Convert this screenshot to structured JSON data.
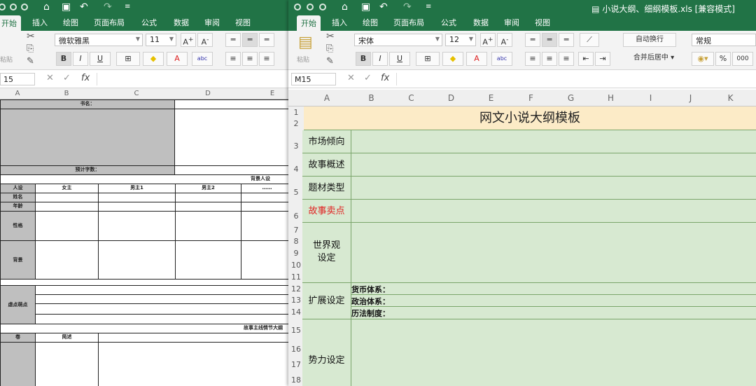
{
  "left_window": {
    "tabs": [
      "开始",
      "插入",
      "绘图",
      "页面布局",
      "公式",
      "数据",
      "审阅",
      "视图"
    ],
    "font_name": "微软雅黑",
    "font_size": "11",
    "paste_label": "粘贴",
    "name_box": "15",
    "fx": "fx",
    "columns": [
      "A",
      "B",
      "C",
      "D",
      "E"
    ],
    "sheet": {
      "book_name": "书名：",
      "word_count": "预计字数：",
      "bg_characters": "背景人设",
      "char_headers": [
        "人设",
        "女主",
        "男主1",
        "男主2",
        "……"
      ],
      "row_name": "姓名",
      "row_age": "年龄",
      "row_personality": "性格",
      "row_background": "背景",
      "row_selling": "虐点萌点",
      "main_plot": "故事主线情节大纲",
      "plot_headers": [
        "卷",
        "简述"
      ]
    }
  },
  "right_window": {
    "doc_title": "小说大纲、细纲模板.xls [兼容模式]",
    "tabs": [
      "开始",
      "插入",
      "绘图",
      "页面布局",
      "公式",
      "数据",
      "审阅",
      "视图"
    ],
    "font_name": "宋体",
    "font_size": "12",
    "paste_label": "粘贴",
    "wrap_label": "自动换行",
    "merge_label": "合并后居中",
    "number_format": "常规",
    "percent": "%",
    "thousand": "000",
    "name_box": "M15",
    "fx": "fx",
    "columns": [
      "A",
      "B",
      "C",
      "D",
      "E",
      "F",
      "G",
      "H",
      "I",
      "J",
      "K"
    ],
    "rows": [
      "1",
      "2",
      "3",
      "4",
      "5",
      "6",
      "7",
      "8",
      "9",
      "10",
      "11",
      "12",
      "13",
      "14",
      "15",
      "16",
      "17",
      "18"
    ],
    "sheet": {
      "title": "网文小说大纲模板",
      "market": "市场倾向",
      "summary": "故事概述",
      "genre": "题材类型",
      "selling_points": "故事卖点",
      "worldview": "世界观设定",
      "extended": "扩展设定",
      "currency": "货币体系：",
      "politics": "政治体系：",
      "calendar": "历法制度：",
      "factions": "势力设定"
    },
    "colors": {
      "accent": "#217346",
      "title_bg": "#fcebc7",
      "row_bg": "#d7e9d1",
      "red_text": "#e02020"
    }
  }
}
